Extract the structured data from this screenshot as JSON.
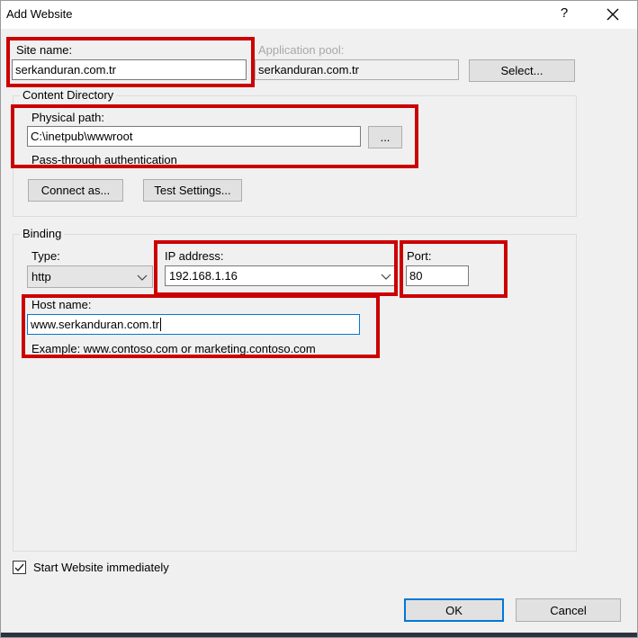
{
  "window": {
    "title": "Add Website",
    "help": "?"
  },
  "site_name": {
    "label": "Site name:",
    "value": "serkanduran.com.tr"
  },
  "app_pool": {
    "label": "Application pool:",
    "value": "serkanduran.com.tr",
    "select_label": "Select..."
  },
  "content_directory": {
    "title": "Content Directory",
    "physical_path_label": "Physical path:",
    "physical_path_value": "C:\\inetpub\\wwwroot",
    "browse_label": "...",
    "auth_text": "Pass-through authentication",
    "connect_as_label": "Connect as...",
    "test_settings_label": "Test Settings..."
  },
  "binding": {
    "title": "Binding",
    "type_label": "Type:",
    "type_value": "http",
    "ip_label": "IP address:",
    "ip_value": "192.168.1.16",
    "port_label": "Port:",
    "port_value": "80",
    "host_label": "Host name:",
    "host_value": "www.serkanduran.com.tr",
    "example_text": "Example: www.contoso.com or marketing.contoso.com"
  },
  "start_website": {
    "label": "Start Website immediately",
    "checked": true
  },
  "footer": {
    "ok_label": "OK",
    "cancel_label": "Cancel"
  },
  "colors": {
    "highlight": "#cc0000",
    "accent": "#0078d7",
    "background": "#f0f0f0"
  },
  "icons": {
    "help": "help-icon",
    "close": "close-icon",
    "chevron": "chevron-down-icon",
    "check": "check-icon"
  }
}
